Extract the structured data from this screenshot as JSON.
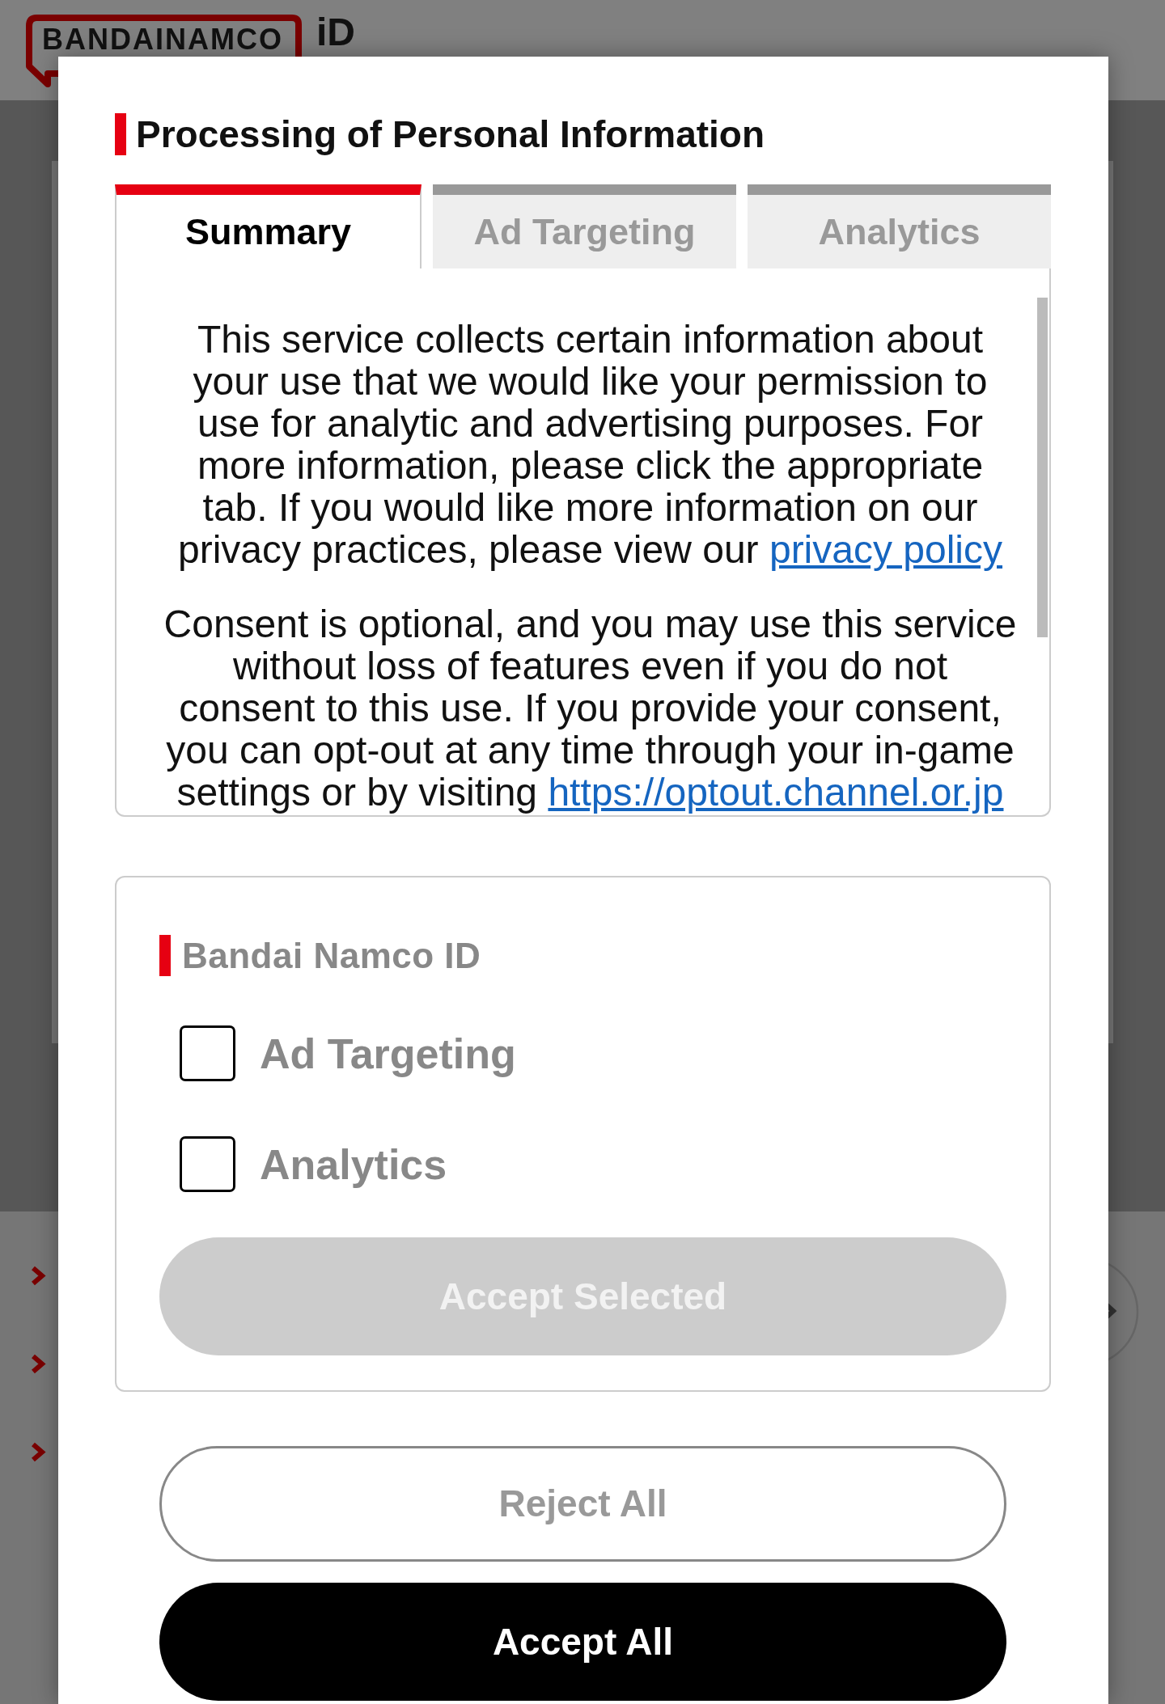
{
  "header": {
    "logo_wordmark": "BANDAINAMCO",
    "logo_suffix": "iD"
  },
  "dialog": {
    "title": "Processing of Personal Information",
    "tabs": [
      {
        "label": "Summary",
        "selected": true
      },
      {
        "label": "Ad Targeting",
        "selected": false
      },
      {
        "label": "Analytics",
        "selected": false
      }
    ],
    "summary": {
      "paragraphs": [
        {
          "text": "This service collects certain information about your use that we would like your permission to use for analytic and advertising purposes. For more information, please click the appropriate tab. If you would like more information on our privacy practices, please view our",
          "link": "privacy policy"
        },
        {
          "text": "Consent is optional, and you may use this service without loss of features even if you do not consent to this use. If you provide your consent, you can opt-out at any time through your in-game settings or by visiting",
          "link": "https://optout.channel.or.jp"
        }
      ]
    },
    "consent_group": {
      "heading": "Bandai Namco ID",
      "options": [
        {
          "label": "Ad Targeting",
          "checked": false
        },
        {
          "label": "Analytics",
          "checked": false
        }
      ],
      "accept_selected": {
        "label": "Accept Selected",
        "disabled": true
      }
    },
    "buttons": [
      {
        "kind": "outline",
        "label": "Reject All"
      },
      {
        "kind": "filled",
        "label": "Accept All"
      }
    ]
  }
}
